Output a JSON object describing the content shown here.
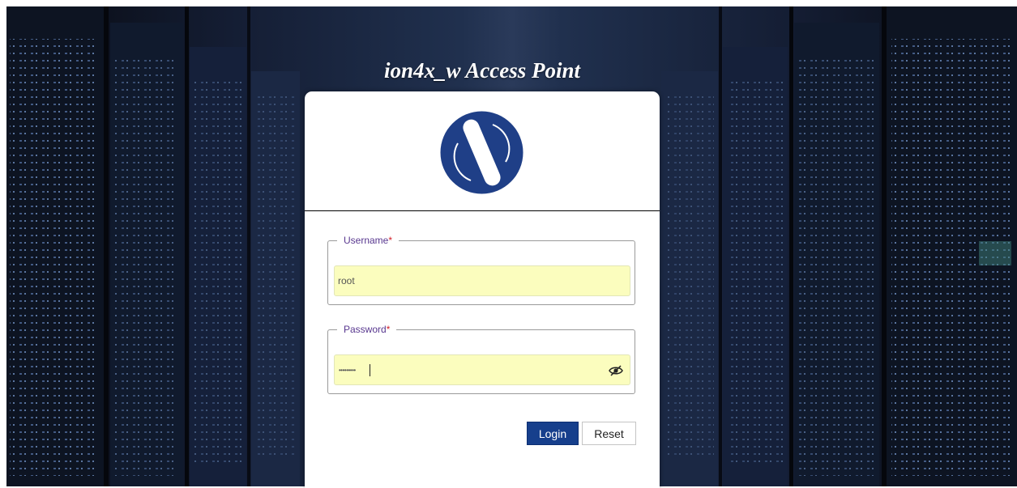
{
  "page": {
    "title": "ion4x_w Access Point",
    "logo": "ion-networks-logo",
    "background": "server-room-image"
  },
  "form": {
    "username_label": "Username",
    "password_label": "Password",
    "required_mark": "*",
    "username_value": "root",
    "password_mask": "•••••••••",
    "password_toggle_icon": "eye-slash-icon"
  },
  "buttons": {
    "login": "Login",
    "reset": "Reset"
  },
  "colors": {
    "primary": "#163f8c",
    "logo_blue": "#1f3f87",
    "autofill": "#fbfdbe",
    "label": "#58378f",
    "required": "#d2212a"
  }
}
